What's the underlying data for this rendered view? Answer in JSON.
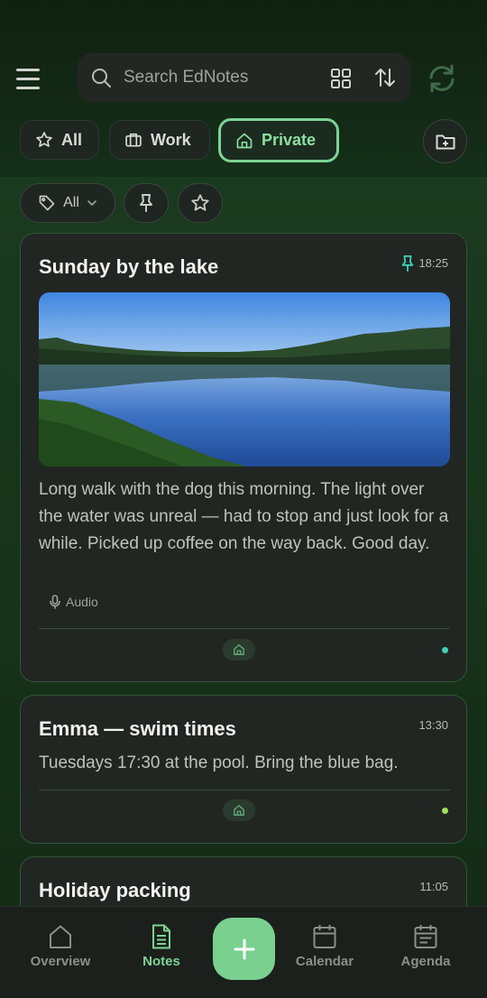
{
  "search": {
    "placeholder": "Search EdNotes"
  },
  "folders": [
    {
      "label": "All",
      "icon": "star-icon",
      "active": false
    },
    {
      "label": "Work",
      "icon": "briefcase-icon",
      "active": false
    },
    {
      "label": "Private",
      "icon": "home-icon",
      "active": true
    }
  ],
  "filters": {
    "tag_label": "All"
  },
  "notes": [
    {
      "title": "Sunday by the lake",
      "time": "18:25",
      "pinned": true,
      "has_image": true,
      "body": "Long walk with the dog this morning. The light over the water was unreal — had to stop and just look for a while. Picked up coffee on the way back. Good day.",
      "attachment": "Audio",
      "dot_color": "#3fd1b4"
    },
    {
      "title": "Emma — swim times",
      "time": "13:30",
      "pinned": false,
      "body": "Tuesdays 17:30 at the pool. Bring the blue bag.",
      "dot_color": "#a8e05a"
    },
    {
      "title": "Holiday packing",
      "time": "11:05",
      "pinned": false
    }
  ],
  "nav": {
    "overview": "Overview",
    "notes": "Notes",
    "calendar": "Calendar",
    "agenda": "Agenda"
  },
  "colors": {
    "accent": "#7dd394",
    "background": "#173319",
    "card": "#212623"
  }
}
